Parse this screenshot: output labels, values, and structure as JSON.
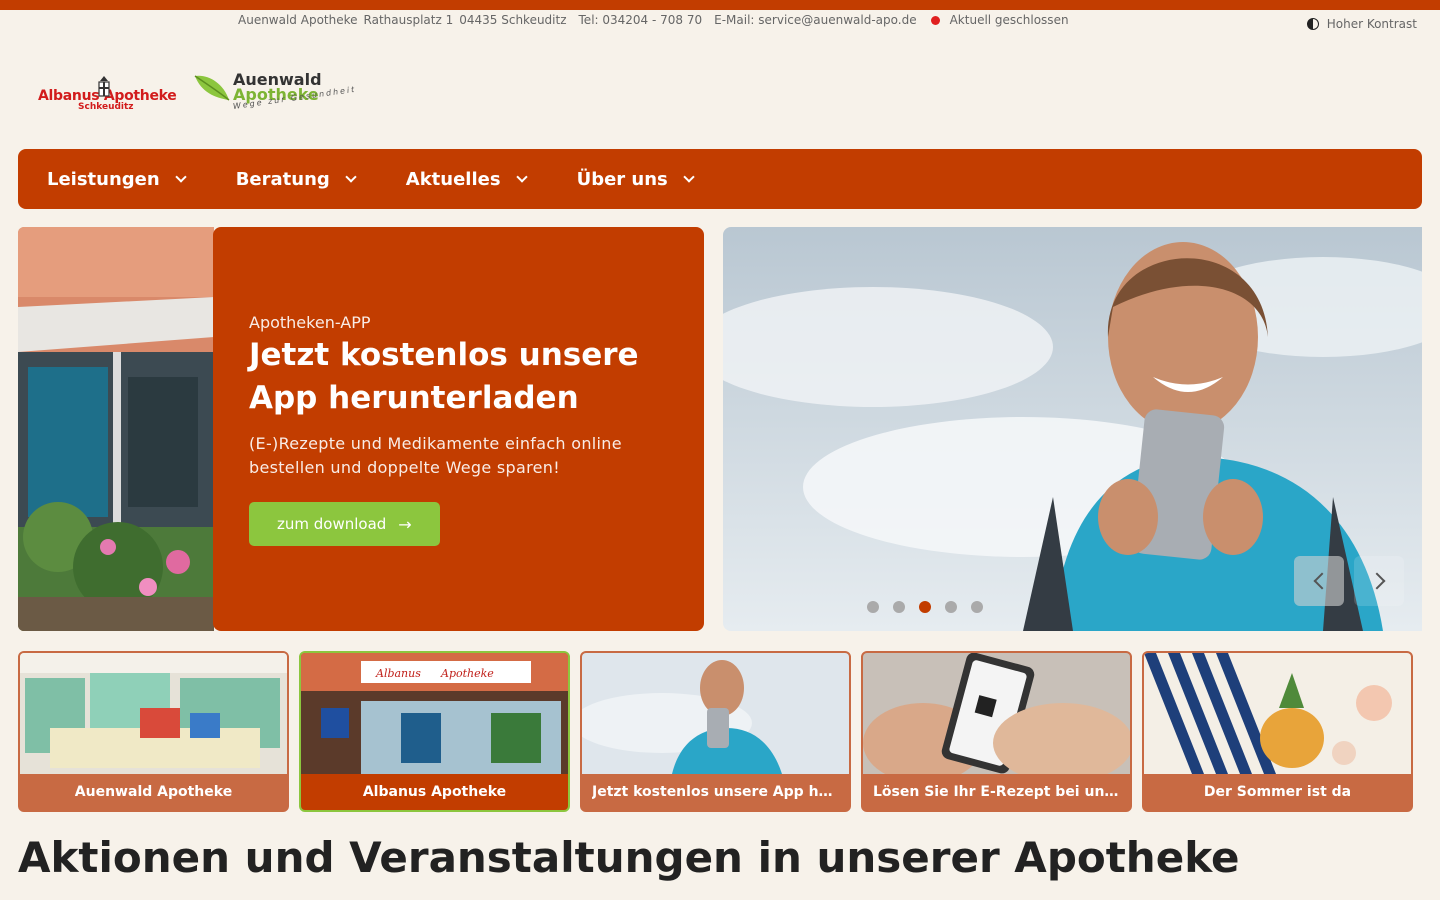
{
  "infobar": {
    "name": "Auenwald Apotheke",
    "street": "Rathausplatz 1",
    "city": "04435 Schkeuditz",
    "phone": "Tel: 034204 - 708 70",
    "email": "E-Mail: service@auenwald-apo.de",
    "status": "Aktuell geschlossen",
    "status_color": "#e0201f"
  },
  "contrast": {
    "label": "Hoher Kontrast",
    "icon": "contrast-icon"
  },
  "logos": {
    "albanus": {
      "brand": "Albanus  Apotheke",
      "sub": "Schkeuditz"
    },
    "auenwald": {
      "line1": "Auenwald",
      "line2": "Apotheke",
      "tagline": "Wege zur Gesundheit"
    }
  },
  "nav": {
    "items": [
      {
        "label": "Leistungen"
      },
      {
        "label": "Beratung"
      },
      {
        "label": "Aktuelles"
      },
      {
        "label": "Über uns"
      }
    ]
  },
  "hero": {
    "eyebrow": "Apotheken-APP",
    "title": "Jetzt kostenlos unsere App herunterladen",
    "text": "(E-)Rezepte und Medikamente einfach online bestellen und doppelte Wege sparen!",
    "button_label": "zum download",
    "button_icon": "arrow-right-icon",
    "active_slide": 3,
    "slide_count": 5
  },
  "thumbs": [
    {
      "label": "Auenwald Apotheke",
      "selected": false
    },
    {
      "label": "Albanus Apotheke",
      "selected": true
    },
    {
      "label": "Jetzt kostenlos unsere App herunterladen",
      "selected": false
    },
    {
      "label": "Lösen Sie Ihr E-Rezept bei uns ein",
      "selected": false
    },
    {
      "label": "Der Sommer ist da",
      "selected": false
    }
  ],
  "section": {
    "title": "Aktionen und Veranstaltungen in unserer Apotheke"
  },
  "colors": {
    "brand": "#c23d00",
    "accent": "#8cc63e",
    "background": "#f7f2ea"
  }
}
